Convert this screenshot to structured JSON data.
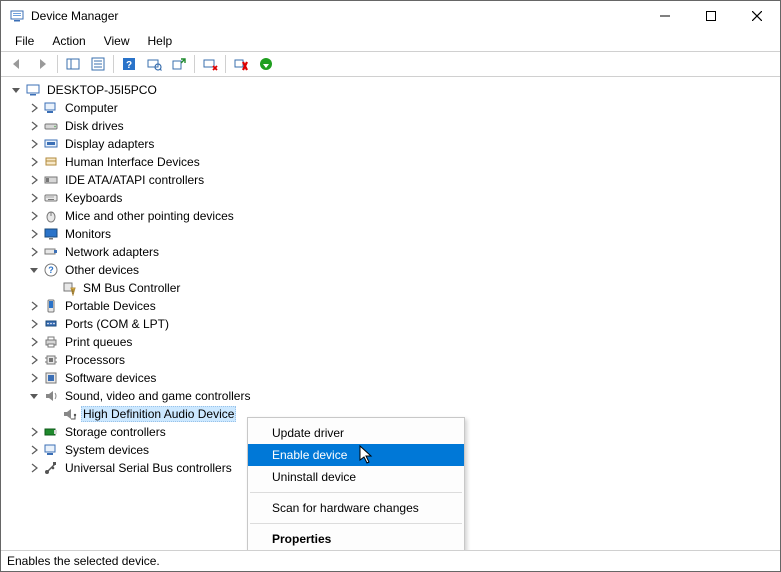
{
  "title": "Device Manager",
  "menu": {
    "file": "File",
    "action": "Action",
    "view": "View",
    "help": "Help"
  },
  "tree": {
    "root": "DESKTOP-J5I5PCO",
    "categories": [
      {
        "label": "Computer"
      },
      {
        "label": "Disk drives"
      },
      {
        "label": "Display adapters"
      },
      {
        "label": "Human Interface Devices"
      },
      {
        "label": "IDE ATA/ATAPI controllers"
      },
      {
        "label": "Keyboards"
      },
      {
        "label": "Mice and other pointing devices"
      },
      {
        "label": "Monitors"
      },
      {
        "label": "Network adapters"
      },
      {
        "label": "Other devices",
        "child": "SM Bus Controller"
      },
      {
        "label": "Portable Devices"
      },
      {
        "label": "Ports (COM & LPT)"
      },
      {
        "label": "Print queues"
      },
      {
        "label": "Processors"
      },
      {
        "label": "Software devices"
      },
      {
        "label": "Sound, video and game controllers",
        "child": "High Definition Audio Device"
      },
      {
        "label": "Storage controllers"
      },
      {
        "label": "System devices"
      },
      {
        "label": "Universal Serial Bus controllers"
      }
    ]
  },
  "context_menu": {
    "update": "Update driver",
    "enable": "Enable device",
    "uninstall": "Uninstall device",
    "scan": "Scan for hardware changes",
    "properties": "Properties"
  },
  "status_text": "Enables the selected device."
}
